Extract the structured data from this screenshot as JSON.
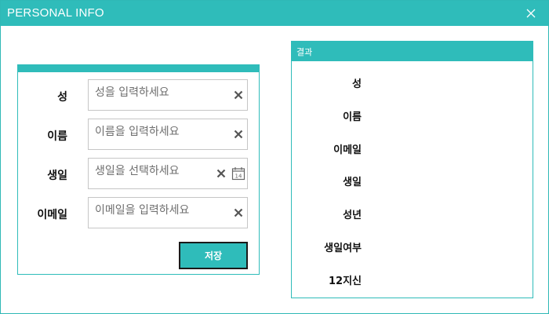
{
  "window": {
    "title": "PERSONAL INFO",
    "accent_color": "#2fbcba",
    "close_icon": "close-icon"
  },
  "form": {
    "fields": [
      {
        "label": "성",
        "placeholder": "성을 입력하세요",
        "value": ""
      },
      {
        "label": "이름",
        "placeholder": "이름을 입력하세요",
        "value": ""
      },
      {
        "label": "생일",
        "placeholder": "생일을 선택하세요",
        "value": "",
        "calendar_day": "14"
      },
      {
        "label": "이메일",
        "placeholder": "이메일을 입력하세요",
        "value": ""
      }
    ],
    "save_label": "저장"
  },
  "result": {
    "header": "결과",
    "labels": [
      "성",
      "이름",
      "이메일",
      "생일",
      "성년",
      "생일여부",
      "12지신"
    ]
  }
}
